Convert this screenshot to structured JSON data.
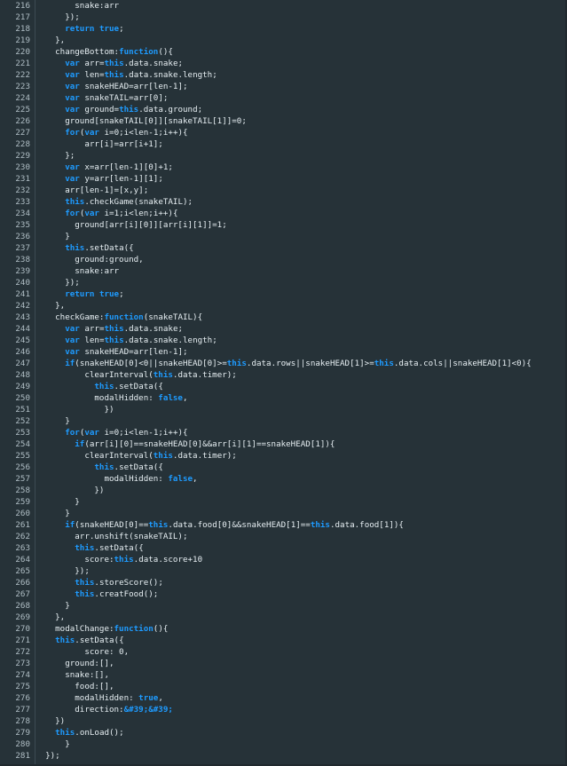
{
  "editor": {
    "first_line_number": 216,
    "lines": [
      [
        [
          "p",
          "        snake:arr"
        ]
      ],
      [
        [
          "p",
          "      });"
        ]
      ],
      [
        [
          "p",
          "      "
        ],
        [
          "k",
          "return"
        ],
        [
          "p",
          " "
        ],
        [
          "k",
          "true"
        ],
        [
          "p",
          ";"
        ]
      ],
      [
        [
          "p",
          "    },"
        ]
      ],
      [
        [
          "p",
          "    changeBottom:"
        ],
        [
          "k",
          "function"
        ],
        [
          "p",
          "(){"
        ]
      ],
      [
        [
          "p",
          "      "
        ],
        [
          "k",
          "var"
        ],
        [
          "p",
          " arr="
        ],
        [
          "t",
          "this"
        ],
        [
          "p",
          ".data.snake;"
        ]
      ],
      [
        [
          "p",
          "      "
        ],
        [
          "k",
          "var"
        ],
        [
          "p",
          " len="
        ],
        [
          "t",
          "this"
        ],
        [
          "p",
          ".data.snake.length;"
        ]
      ],
      [
        [
          "p",
          "      "
        ],
        [
          "k",
          "var"
        ],
        [
          "p",
          " snakeHEAD=arr[len-1];"
        ]
      ],
      [
        [
          "p",
          "      "
        ],
        [
          "k",
          "var"
        ],
        [
          "p",
          " snakeTAIL=arr[0];"
        ]
      ],
      [
        [
          "p",
          "      "
        ],
        [
          "k",
          "var"
        ],
        [
          "p",
          " ground="
        ],
        [
          "t",
          "this"
        ],
        [
          "p",
          ".data.ground;"
        ]
      ],
      [
        [
          "p",
          "      ground[snakeTAIL[0]][snakeTAIL[1]]=0;"
        ]
      ],
      [
        [
          "p",
          "      "
        ],
        [
          "k",
          "for"
        ],
        [
          "p",
          "("
        ],
        [
          "k",
          "var"
        ],
        [
          "p",
          " i=0;i<len-1;i++){"
        ]
      ],
      [
        [
          "p",
          "          arr[i]=arr[i+1];"
        ]
      ],
      [
        [
          "p",
          "      };"
        ]
      ],
      [
        [
          "p",
          "      "
        ],
        [
          "k",
          "var"
        ],
        [
          "p",
          " x=arr[len-1][0]+1;"
        ]
      ],
      [
        [
          "p",
          "      "
        ],
        [
          "k",
          "var"
        ],
        [
          "p",
          " y=arr[len-1][1];"
        ]
      ],
      [
        [
          "p",
          "      arr[len-1]=[x,y];"
        ]
      ],
      [
        [
          "p",
          "      "
        ],
        [
          "t",
          "this"
        ],
        [
          "p",
          ".checkGame(snakeTAIL);"
        ]
      ],
      [
        [
          "p",
          "      "
        ],
        [
          "k",
          "for"
        ],
        [
          "p",
          "("
        ],
        [
          "k",
          "var"
        ],
        [
          "p",
          " i=1;i<len;i++){"
        ]
      ],
      [
        [
          "p",
          "        ground[arr[i][0]][arr[i][1]]=1;"
        ]
      ],
      [
        [
          "p",
          "      }"
        ]
      ],
      [
        [
          "p",
          "      "
        ],
        [
          "t",
          "this"
        ],
        [
          "p",
          ".setData({"
        ]
      ],
      [
        [
          "p",
          "        ground:ground,"
        ]
      ],
      [
        [
          "p",
          "        snake:arr"
        ]
      ],
      [
        [
          "p",
          "      });"
        ]
      ],
      [
        [
          "p",
          "      "
        ],
        [
          "k",
          "return"
        ],
        [
          "p",
          " "
        ],
        [
          "k",
          "true"
        ],
        [
          "p",
          ";"
        ]
      ],
      [
        [
          "p",
          "    },"
        ]
      ],
      [
        [
          "p",
          "    checkGame:"
        ],
        [
          "k",
          "function"
        ],
        [
          "p",
          "(snakeTAIL){"
        ]
      ],
      [
        [
          "p",
          "      "
        ],
        [
          "k",
          "var"
        ],
        [
          "p",
          " arr="
        ],
        [
          "t",
          "this"
        ],
        [
          "p",
          ".data.snake;"
        ]
      ],
      [
        [
          "p",
          "      "
        ],
        [
          "k",
          "var"
        ],
        [
          "p",
          " len="
        ],
        [
          "t",
          "this"
        ],
        [
          "p",
          ".data.snake.length;"
        ]
      ],
      [
        [
          "p",
          "      "
        ],
        [
          "k",
          "var"
        ],
        [
          "p",
          " snakeHEAD=arr[len-1];"
        ]
      ],
      [
        [
          "p",
          "      "
        ],
        [
          "k",
          "if"
        ],
        [
          "p",
          "(snakeHEAD[0]<0||snakeHEAD[0]>="
        ],
        [
          "t",
          "this"
        ],
        [
          "p",
          ".data.rows||snakeHEAD[1]>="
        ],
        [
          "t",
          "this"
        ],
        [
          "p",
          ".data.cols||snakeHEAD[1]<0){"
        ]
      ],
      [
        [
          "p",
          "          clearInterval("
        ],
        [
          "t",
          "this"
        ],
        [
          "p",
          ".data.timer);"
        ]
      ],
      [
        [
          "p",
          "            "
        ],
        [
          "t",
          "this"
        ],
        [
          "p",
          ".setData({"
        ]
      ],
      [
        [
          "p",
          "            modalHidden: "
        ],
        [
          "k",
          "false"
        ],
        [
          "p",
          ","
        ]
      ],
      [
        [
          "p",
          "              })"
        ]
      ],
      [
        [
          "p",
          "      }"
        ]
      ],
      [
        [
          "p",
          "      "
        ],
        [
          "k",
          "for"
        ],
        [
          "p",
          "("
        ],
        [
          "k",
          "var"
        ],
        [
          "p",
          " i=0;i<len-1;i++){"
        ]
      ],
      [
        [
          "p",
          "        "
        ],
        [
          "k",
          "if"
        ],
        [
          "p",
          "(arr[i][0]==snakeHEAD[0]&&arr[i][1]==snakeHEAD[1]){"
        ]
      ],
      [
        [
          "p",
          "          clearInterval("
        ],
        [
          "t",
          "this"
        ],
        [
          "p",
          ".data.timer);"
        ]
      ],
      [
        [
          "p",
          "            "
        ],
        [
          "t",
          "this"
        ],
        [
          "p",
          ".setData({"
        ]
      ],
      [
        [
          "p",
          "              modalHidden: "
        ],
        [
          "k",
          "false"
        ],
        [
          "p",
          ","
        ]
      ],
      [
        [
          "p",
          "            })"
        ]
      ],
      [
        [
          "p",
          "        }"
        ]
      ],
      [
        [
          "p",
          "      }"
        ]
      ],
      [
        [
          "p",
          "      "
        ],
        [
          "k",
          "if"
        ],
        [
          "p",
          "(snakeHEAD[0]=="
        ],
        [
          "t",
          "this"
        ],
        [
          "p",
          ".data.food[0]&&snakeHEAD[1]=="
        ],
        [
          "t",
          "this"
        ],
        [
          "p",
          ".data.food[1]){"
        ]
      ],
      [
        [
          "p",
          "        arr.unshift(snakeTAIL);"
        ]
      ],
      [
        [
          "p",
          "        "
        ],
        [
          "t",
          "this"
        ],
        [
          "p",
          ".setData({"
        ]
      ],
      [
        [
          "p",
          "          score:"
        ],
        [
          "t",
          "this"
        ],
        [
          "p",
          ".data.score+10"
        ]
      ],
      [
        [
          "p",
          "        });"
        ]
      ],
      [
        [
          "p",
          "        "
        ],
        [
          "t",
          "this"
        ],
        [
          "p",
          ".storeScore();"
        ]
      ],
      [
        [
          "p",
          "        "
        ],
        [
          "t",
          "this"
        ],
        [
          "p",
          ".creatFood();"
        ]
      ],
      [
        [
          "p",
          "      }"
        ]
      ],
      [
        [
          "p",
          "    },"
        ]
      ],
      [
        [
          "p",
          "    modalChange:"
        ],
        [
          "k",
          "function"
        ],
        [
          "p",
          "(){"
        ]
      ],
      [
        [
          "p",
          "    "
        ],
        [
          "t",
          "this"
        ],
        [
          "p",
          ".setData({"
        ]
      ],
      [
        [
          "p",
          "          score: 0,"
        ]
      ],
      [
        [
          "p",
          "      ground:[],"
        ]
      ],
      [
        [
          "p",
          "      snake:[],"
        ]
      ],
      [
        [
          "p",
          "        food:[],"
        ]
      ],
      [
        [
          "p",
          "        modalHidden: "
        ],
        [
          "k",
          "true"
        ],
        [
          "p",
          ","
        ]
      ],
      [
        [
          "p",
          "        direction:"
        ],
        [
          "k",
          "&#39;&#39;"
        ]
      ],
      [
        [
          "p",
          "    })"
        ]
      ],
      [
        [
          "p",
          "    "
        ],
        [
          "t",
          "this"
        ],
        [
          "p",
          ".onLoad();"
        ]
      ],
      [
        [
          "p",
          "      }"
        ]
      ],
      [
        [
          "p",
          "  });"
        ]
      ]
    ]
  },
  "colors": {
    "background": "#263238",
    "text": "#e6eef2",
    "keyword": "#1e9bff",
    "line_number": "#b0bec5",
    "gutter_border": "#3c4a52"
  }
}
